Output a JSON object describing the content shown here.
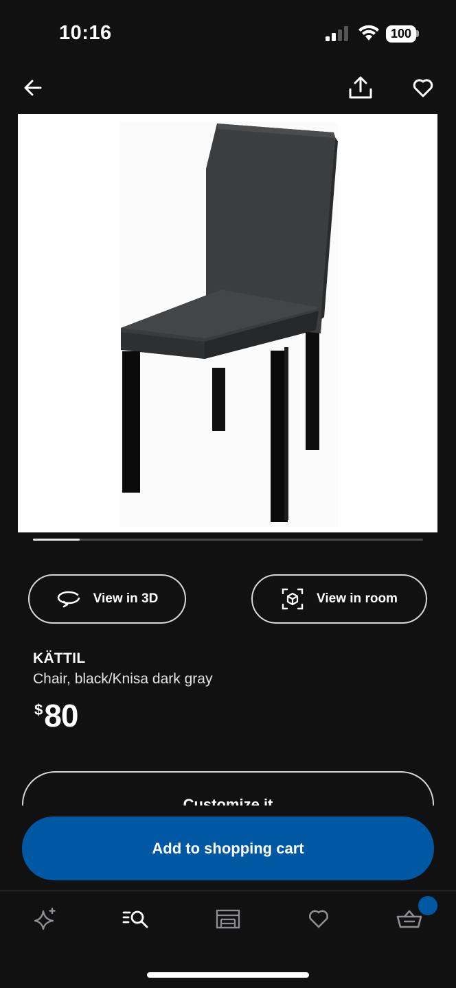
{
  "status_bar": {
    "time": "10:16",
    "battery": "100"
  },
  "top_nav": {
    "back_icon": "arrow-left-icon",
    "share_icon": "share-icon",
    "favorite_icon": "heart-icon"
  },
  "product": {
    "name": "KÄTTIL",
    "description": "Chair, black/Knisa dark gray",
    "price_currency": "$",
    "price_value": "80",
    "image_index_fraction": 0.12
  },
  "actions": {
    "view_3d_label": "View in 3D",
    "view_room_label": "View in room",
    "customize_label": "Customize it",
    "add_to_cart_label": "Add to shopping cart"
  },
  "tab_bar": {
    "items": [
      {
        "icon": "sparkle-icon"
      },
      {
        "icon": "search-list-icon"
      },
      {
        "icon": "store-icon"
      },
      {
        "icon": "heart-icon"
      },
      {
        "icon": "basket-icon"
      }
    ]
  },
  "colors": {
    "background": "#111112",
    "accent": "#0058a3",
    "text": "#ffffff"
  }
}
